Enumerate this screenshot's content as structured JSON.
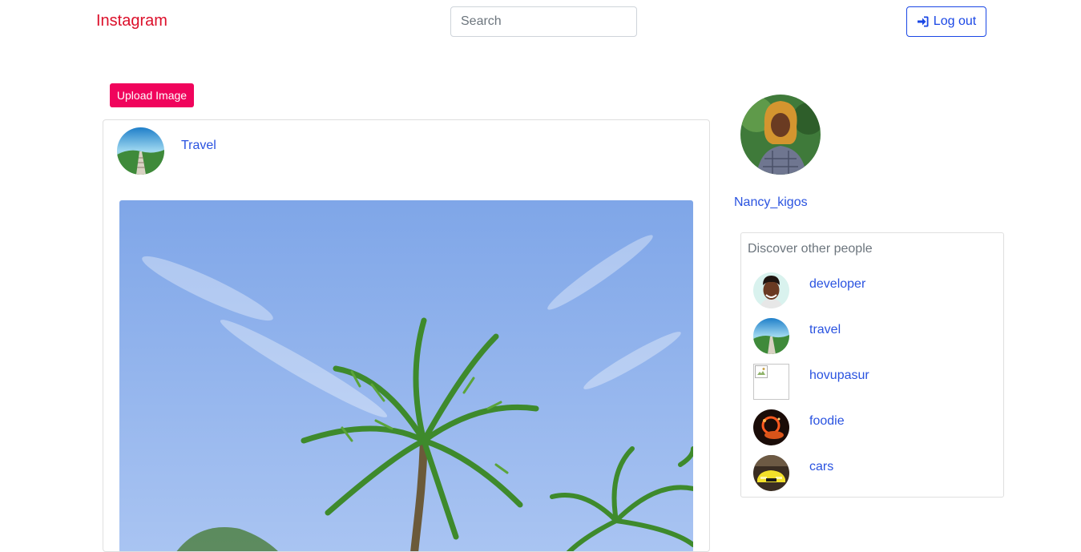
{
  "navbar": {
    "brand": "Instagram",
    "search_placeholder": "Search",
    "logout_label": "Log out",
    "logout_icon": "sign-in-icon"
  },
  "upload_label": "Upload Image",
  "post": {
    "username": "Travel"
  },
  "profile": {
    "username": "Nancy_kigos"
  },
  "discover": {
    "title": "Discover other people",
    "people": [
      {
        "name": "developer"
      },
      {
        "name": "travel"
      },
      {
        "name": "hovupasur"
      },
      {
        "name": "foodie"
      },
      {
        "name": "cars"
      }
    ]
  },
  "colors": {
    "brand": "#dc0f2a",
    "accent": "#1a47e5",
    "upload": "#f0045c",
    "link": "#2a53e0"
  }
}
